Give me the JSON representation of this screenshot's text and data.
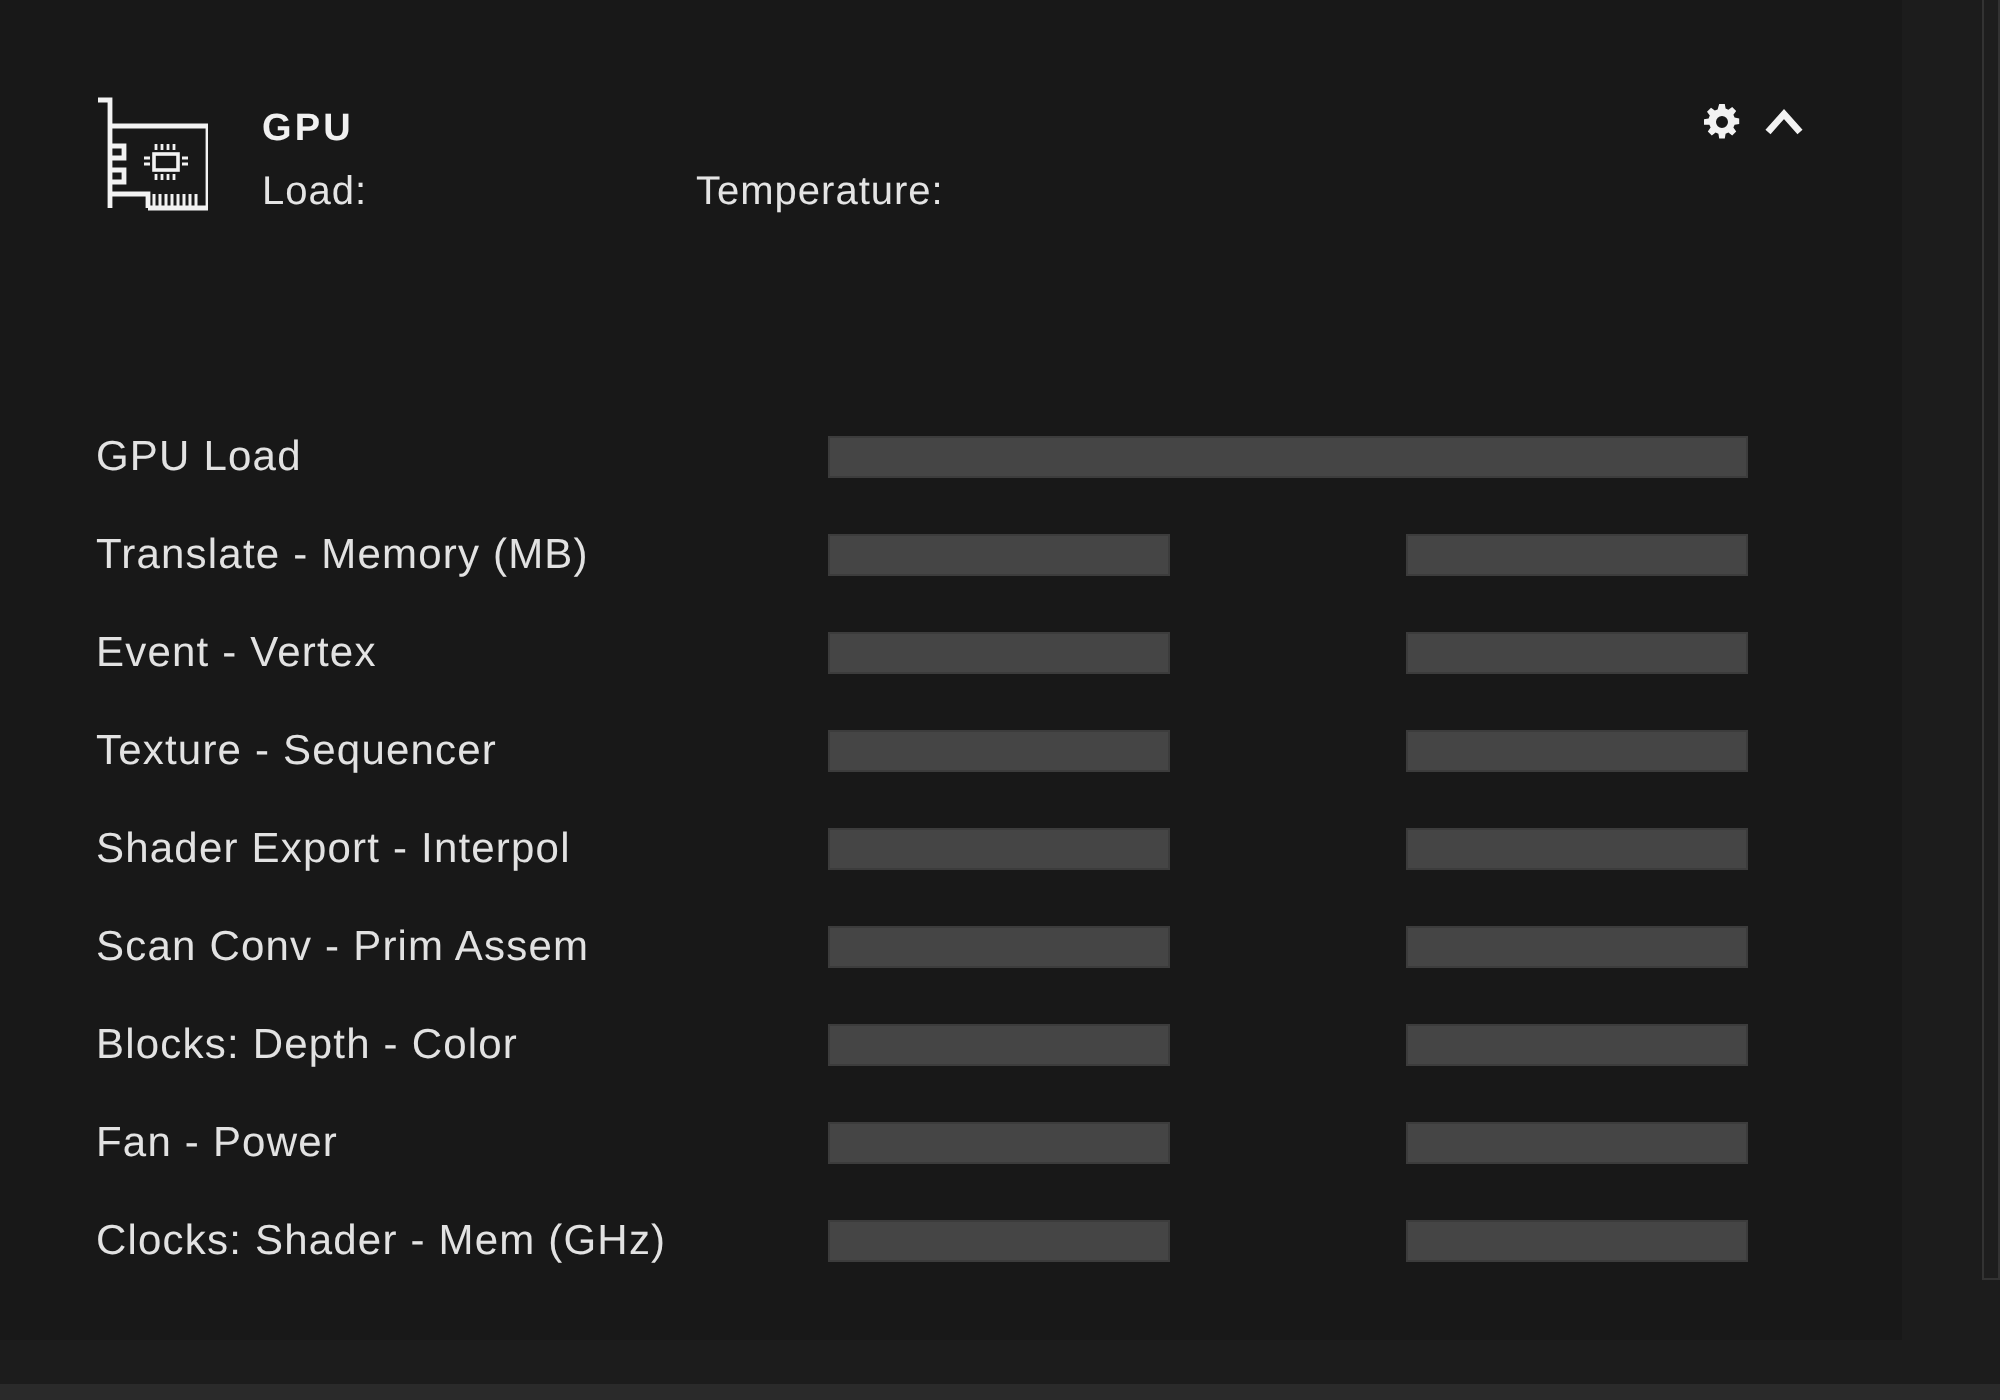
{
  "panel": {
    "title": "GPU",
    "summary": [
      {
        "label": "Load:"
      },
      {
        "label": "Temperature:"
      }
    ],
    "rows": [
      {
        "label": "GPU Load",
        "kind": "single"
      },
      {
        "label": "Translate - Memory (MB)",
        "kind": "pair"
      },
      {
        "label": "Event - Vertex",
        "kind": "pair"
      },
      {
        "label": "Texture - Sequencer",
        "kind": "pair"
      },
      {
        "label": "Shader Export - Interpol",
        "kind": "pair"
      },
      {
        "label": "Scan Conv - Prim Assem",
        "kind": "pair"
      },
      {
        "label": "Blocks: Depth - Color",
        "kind": "pair"
      },
      {
        "label": "Fan - Power",
        "kind": "pair"
      },
      {
        "label": "Clocks: Shader - Mem (GHz)",
        "kind": "pair"
      }
    ]
  }
}
